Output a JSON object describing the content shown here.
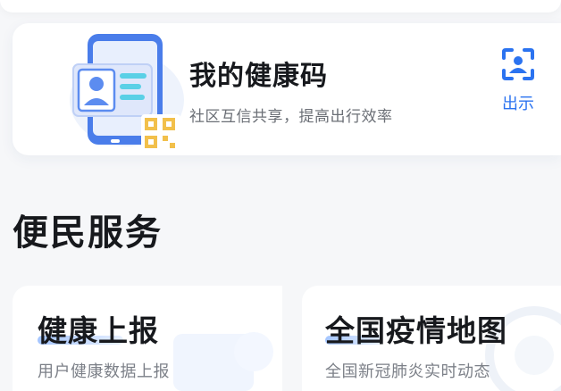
{
  "health_code": {
    "title": "我的健康码",
    "subtitle": "社区互信共享，提高出行效率",
    "show_label": "出示",
    "icon": "scan-icon"
  },
  "section": {
    "title": "便民服务"
  },
  "services": [
    {
      "title": "健康上报",
      "subtitle": "用户健康数据上报"
    },
    {
      "title": "全国疫情地图",
      "subtitle": "全国新冠肺炎实时动态"
    }
  ],
  "colors": {
    "accent": "#2b73f0",
    "title": "#17191d",
    "subtitle": "#6b6f76"
  }
}
